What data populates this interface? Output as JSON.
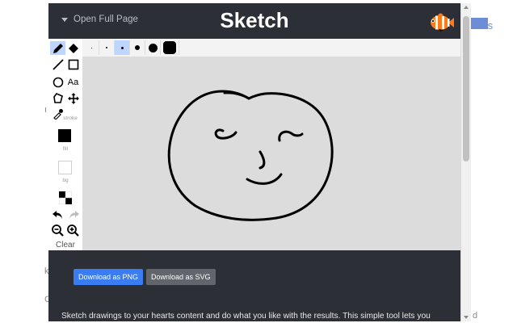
{
  "background": {
    "fragment_right_top": "ıs",
    "fragment_left_1": "ı",
    "fragment_left_2": "k",
    "fragment_left_3": "C",
    "fragment_right_bottom": "d"
  },
  "header": {
    "open_full_page": "Open Full Page",
    "title": "Sketch",
    "logo_icon": "clownfish-icon"
  },
  "toolbar": {
    "stroke_label": "stroke",
    "fill_label": "fill",
    "bg_label": "bg",
    "clear_label": "Clear",
    "active_tool": "pencil",
    "stroke_color": "#000000",
    "fill_color": "#000000",
    "bg_color": "#ffffff",
    "text_tool_label": "Aa"
  },
  "brush_sizes": {
    "options": 7,
    "active_index": 2
  },
  "canvas": {
    "background": "#dcdcdc",
    "drawing": "hand-drawn face"
  },
  "actions": {
    "download_png": "Download as PNG",
    "download_svg": "Download as SVG"
  },
  "description": "Sketch drawings to your hearts content and do what you like with the results. This simple tool lets you",
  "colors": {
    "panel": "#2c2f36",
    "accent": "#3a7cf2",
    "secondary_button": "#62656b",
    "active_tool": "#bcd6ff"
  }
}
